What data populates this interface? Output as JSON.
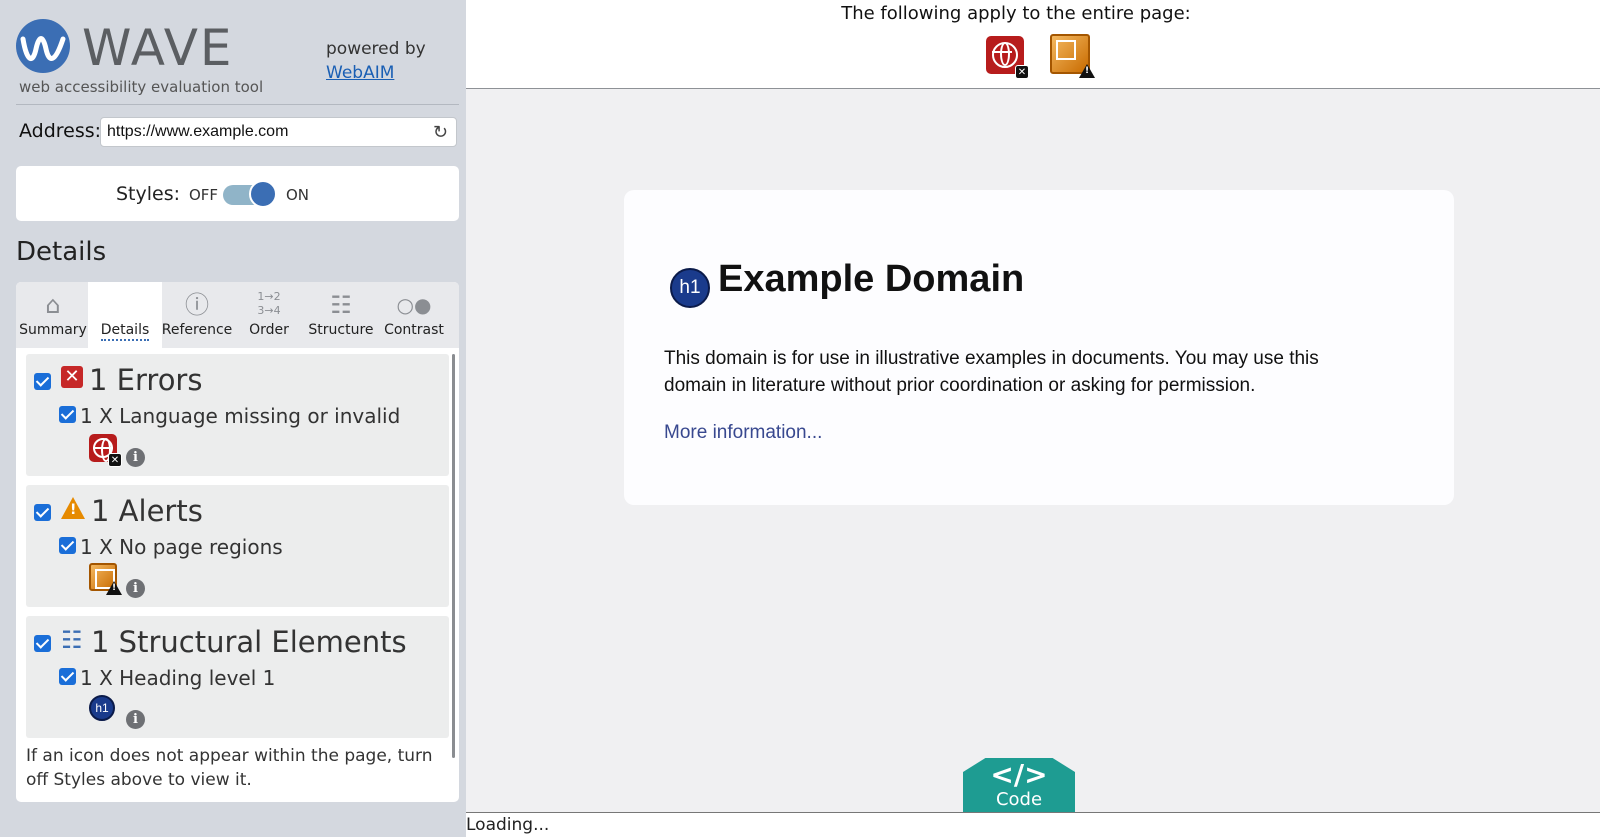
{
  "brand": {
    "name": "WAVE",
    "tagline": "web accessibility evaluation tool",
    "powered_by": "powered by",
    "webaim_link": "WebAIM",
    "accent": "#3b6eb4"
  },
  "address": {
    "label": "Address:",
    "value": "https://www.example.com",
    "refresh_icon": "refresh-icon"
  },
  "styles": {
    "label": "Styles:",
    "off": "OFF",
    "on": "ON",
    "state": "on"
  },
  "details_heading": "Details",
  "tabs": [
    {
      "label": "Summary",
      "icon": "home-icon",
      "active": false
    },
    {
      "label": "Details",
      "icon": "details-icon",
      "active": true
    },
    {
      "label": "Reference",
      "icon": "info-icon",
      "active": false
    },
    {
      "label": "Order",
      "icon": "order-icon",
      "active": false
    },
    {
      "label": "Structure",
      "icon": "structure-icon",
      "active": false
    },
    {
      "label": "Contrast",
      "icon": "contrast-icon",
      "active": false
    }
  ],
  "categories": {
    "errors": {
      "title": "1 Errors",
      "item": "1 X Language missing or invalid",
      "color": "#c62828"
    },
    "alerts": {
      "title": "1 Alerts",
      "item": "1 X No page regions",
      "color": "#e68a00"
    },
    "structure": {
      "title": "1 Structural Elements",
      "item": "1 X Heading level 1",
      "color": "#3b6eb4"
    }
  },
  "panel_note": "If an icon does not appear within the page, turn off Styles above to view it.",
  "main": {
    "topbar_text": "The following apply to the entire page:",
    "h1_badge": "h1",
    "title": "Example Domain",
    "body": "This domain is for use in illustrative examples in documents. You may use this domain in literature without prior coordination or asking for permission.",
    "link": "More information...",
    "code_icon": "</>",
    "code_label": "Code",
    "status": "Loading..."
  }
}
